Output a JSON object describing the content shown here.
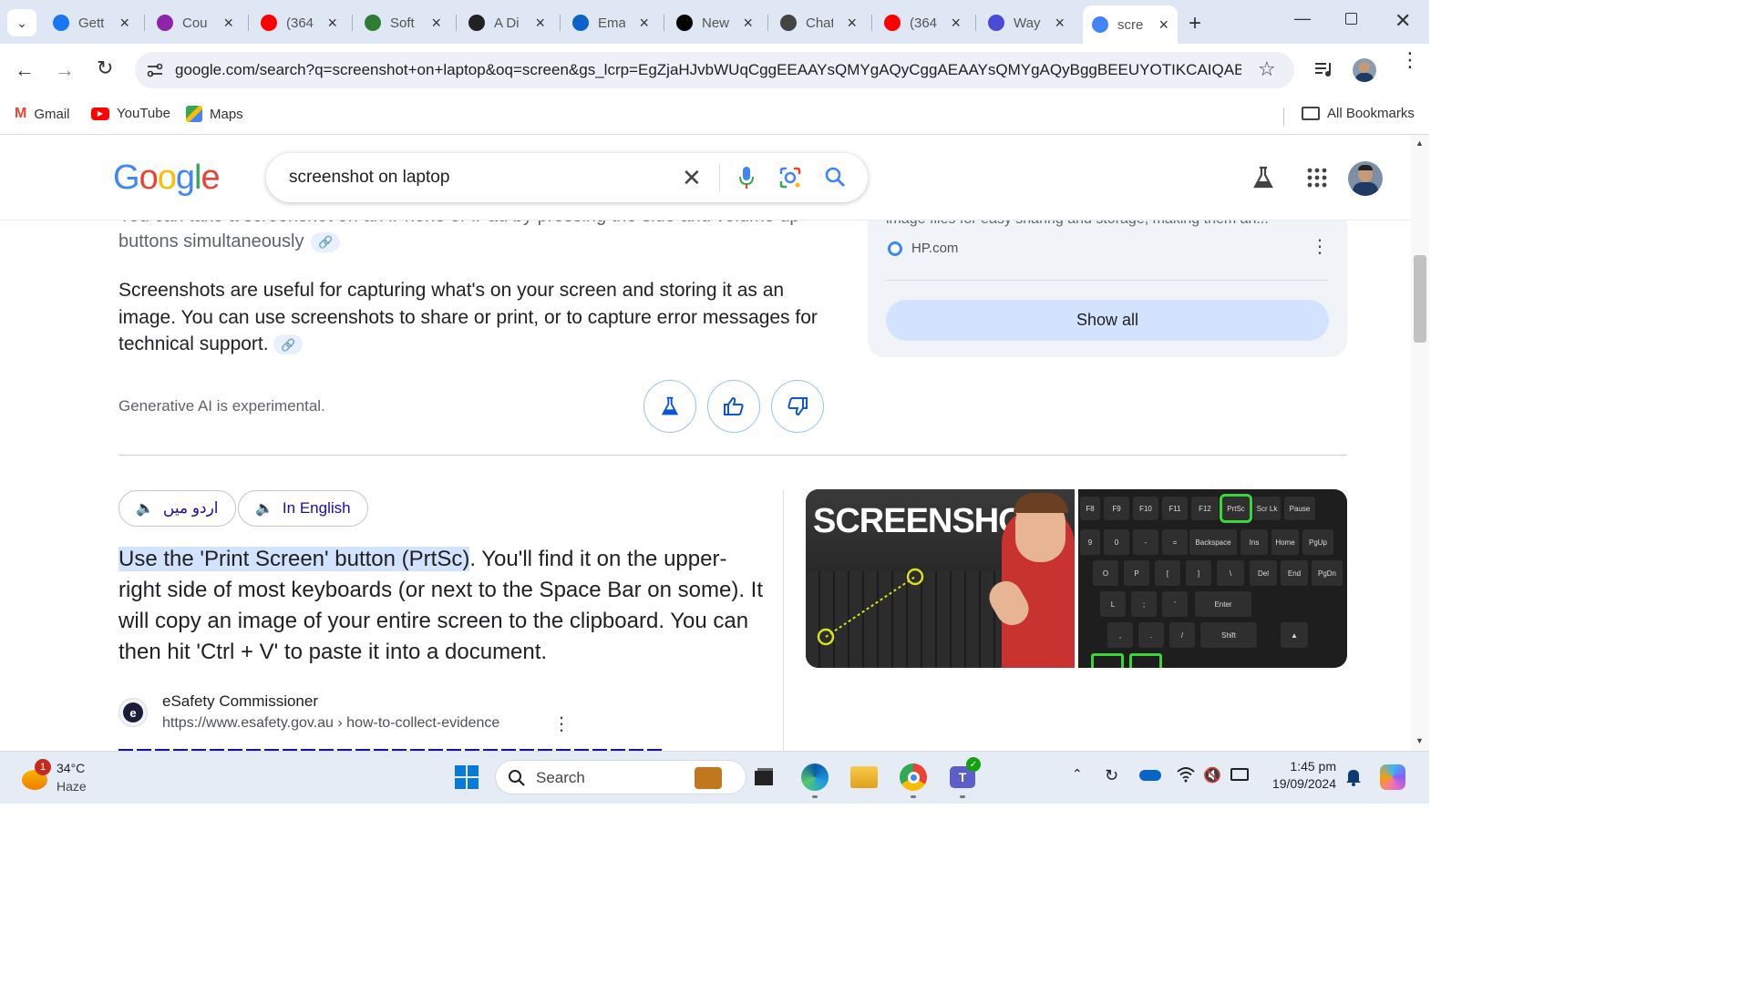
{
  "browser": {
    "tabs": [
      {
        "title": "Gett",
        "icon": "facebook-icon",
        "color": "#1877f2"
      },
      {
        "title": "Cou",
        "icon": "purple-circle-icon",
        "color": "#8e24aa"
      },
      {
        "title": "(364",
        "icon": "youtube-icon",
        "color": "#ff0000"
      },
      {
        "title": "Soft",
        "icon": "green-leaf-icon",
        "color": "#2e7d32"
      },
      {
        "title": "A Di",
        "icon": "chat-bubble-icon",
        "color": "#222222"
      },
      {
        "title": "Ema",
        "icon": "outlook-icon",
        "color": "#0a64c8"
      },
      {
        "title": "New",
        "icon": "medium-icon",
        "color": "#000000"
      },
      {
        "title": "Chat",
        "icon": "openai-icon",
        "color": "#444444"
      },
      {
        "title": "(364",
        "icon": "youtube-icon",
        "color": "#ff0000"
      },
      {
        "title": "Way",
        "icon": "ring-icon",
        "color": "#4b4bd6"
      },
      {
        "title": "scre",
        "icon": "google-icon",
        "color": "#4285f4"
      }
    ],
    "url": "google.com/search?q=screenshot+on+laptop&oq=screen&gs_lcrp=EgZjaHJvbWUqCggEEAAYsQMYgAQyCggAEAAYsQMYgAQyBggBEEUYOTIKCAIQABix...",
    "bookmarks": [
      {
        "label": "Gmail",
        "icon": "gmail-icon"
      },
      {
        "label": "YouTube",
        "icon": "youtube-icon"
      },
      {
        "label": "Maps",
        "icon": "maps-icon"
      }
    ],
    "all_bookmarks": "All Bookmarks"
  },
  "google": {
    "logo": "Google",
    "query": "screenshot on laptop"
  },
  "ai_overview": {
    "partial_line": "You can take a screenshot on an iPhone or iPad by pressing the side and volume up",
    "line2": "buttons simultaneously",
    "paragraph": "Screenshots are useful for capturing what's on your screen and storing it as an image. You can use screenshots to share or print, or to capture error messages for technical support.",
    "disclaimer": "Generative AI is experimental.",
    "side_partial": "image files for easy sharing and storage, making them an...",
    "side_source": "HP.com",
    "show_all": "Show all"
  },
  "featured": {
    "lang_urdu": "اردو میں",
    "lang_english": "In English",
    "highlight": "Use the 'Print Screen' button (PrtSc)",
    "rest": ". You'll find it on the upper-right side of most keyboards (or next to the Space Bar on some). It will copy an image of your entire screen to the clipboard. You can then hit 'Ctrl + V' to paste it into a document.",
    "source_name": "eSafety Commissioner",
    "source_url": "https://www.esafety.gov.au › how-to-collect-evidence",
    "image1_text": "SCREENSHOT",
    "keys_row1": [
      "F8",
      "F9",
      "F10",
      "F11",
      "F12",
      "PrtSc",
      "Scr Lk",
      "Pause"
    ],
    "keys_row2": [
      "9",
      "0",
      "-",
      "=",
      "Backspace",
      "Ins",
      "Home",
      "PgUp"
    ],
    "keys_row3": [
      "O",
      "P",
      "[",
      "]",
      "\\",
      "Del",
      "End",
      "PgDn"
    ],
    "keys_row4": [
      "L",
      ";",
      "'",
      "Enter"
    ],
    "keys_row5": [
      ",",
      ".",
      "/",
      "Shift"
    ]
  },
  "taskbar": {
    "weather_temp": "34°C",
    "weather_desc": "Haze",
    "weather_badge": "1",
    "search_placeholder": "Search",
    "time": "1:45 pm",
    "date": "19/09/2024"
  }
}
